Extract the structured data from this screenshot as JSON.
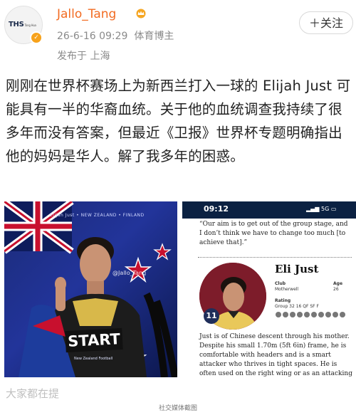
{
  "header": {
    "avatar_logo": "THS",
    "avatar_logo_sub": "Tang Hua",
    "username": "Jallo_Tang",
    "timestamp": "26-6-16 09:29",
    "user_title": "体育博主",
    "location": "发布于 上海",
    "follow_label": "＋关注"
  },
  "post": {
    "text": "刚刚在世界杯赛场上为新西兰打入一球的 Elijah Just 可能具有一半的华裔血统。关于他的血统调查我持续了很多年而没有答案，但最近《卫报》世界杯专题明确指出他的妈妈是华人。解了我多年的困惑。"
  },
  "image_left": {
    "caption": "Elijah Just • NEW ZEALAND • FINLAND",
    "start_label": "START",
    "watermark": "@Jallo_Tang",
    "federation": "New Zealand Football"
  },
  "image_right": {
    "time": "09:12",
    "network": "5G",
    "quote": "“Our aim is to get out of the group stage, and I don’t think we have to change too much [to achieve that].”",
    "player_name": "Eli Just",
    "number": "11",
    "club_label": "Club",
    "club_value": "Motherwell",
    "age_label": "Age",
    "age_value": "26",
    "rating_label": "Rating",
    "rating_stages": "Group   32   16   QF   SF   F",
    "description": "Just is of Chinese descent through his mother. Despite his small 1.70m (5ft 6in) frame, he is comfortable with headers and is a smart attacker who thrives in tight spaces. He is often used on the right wing or as an attacking"
  },
  "footer": {
    "cut_text": "大家都在提",
    "credit": "社交媒体截图"
  }
}
